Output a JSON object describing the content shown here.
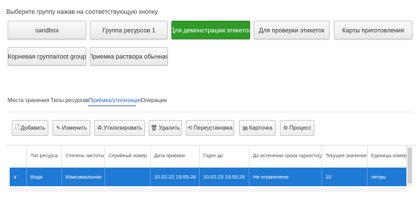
{
  "prompt": "Выберите группу нажав на соответствующую кнопку",
  "groups": [
    {
      "label": "sandbox"
    },
    {
      "label": "Группа ресурсов 1"
    },
    {
      "label": "Для демонстрации этикеток"
    },
    {
      "label": "Для проверки этикеток"
    },
    {
      "label": "Карты приготовления"
    },
    {
      "label": "Корневая группа/root group"
    },
    {
      "label": "Приемка раствора обычная"
    }
  ],
  "active_group": "Для демонстрации этикеток",
  "tabs": [
    {
      "label": "Места хранения"
    },
    {
      "label": "Типы ресурсов"
    },
    {
      "label": "Приёмка/утилизация"
    },
    {
      "label": "Операции"
    }
  ],
  "active_tab": "Приёмка/утилизация",
  "toolbar": [
    {
      "label": "Добавить",
      "icon": "document-icon"
    },
    {
      "label": "Изменить",
      "icon": "edit-icon"
    },
    {
      "label": "Утилизировать",
      "icon": "recycle-icon"
    },
    {
      "label": "Удалить",
      "icon": "trash-icon"
    },
    {
      "label": "Переустановка",
      "icon": "reinstall-icon"
    },
    {
      "label": "Карточка",
      "icon": "card-icon"
    },
    {
      "label": "Процесс",
      "icon": "process-icon"
    }
  ],
  "table": {
    "columns": [
      "",
      "Тип ресурса",
      "Степень чистоты",
      "Серийный номер",
      "Дата приемки",
      "Годен до",
      "До истечения срока годности(д)",
      "Текущее значение",
      "Единицы измерения"
    ],
    "rows": [
      [
        "∨",
        "Вода",
        "Максимальная",
        "",
        "10.02.22 15:55:26",
        "10.02.23 15:55:26",
        "Не ограничено",
        "10",
        "литры"
      ]
    ]
  },
  "colors": {
    "accent": "#2f9a27",
    "selection": "#1f7ad6",
    "link": "#2a6cc5"
  }
}
